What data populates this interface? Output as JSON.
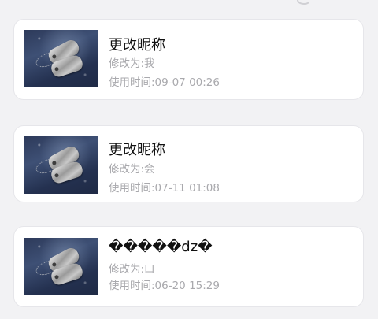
{
  "records": [
    {
      "title": "更改昵称",
      "changed_to": "修改为:我",
      "used_time": "使用时间:09-07 00:26"
    },
    {
      "title": "更改昵称",
      "changed_to": "修改为:会",
      "used_time": "使用时间:07-11 01:08"
    },
    {
      "title": "�����dz�",
      "changed_to": "修改为:口",
      "used_time": "使用时间:06-20 15:29"
    }
  ],
  "thumbnail_icon": "dog-tags-icon"
}
